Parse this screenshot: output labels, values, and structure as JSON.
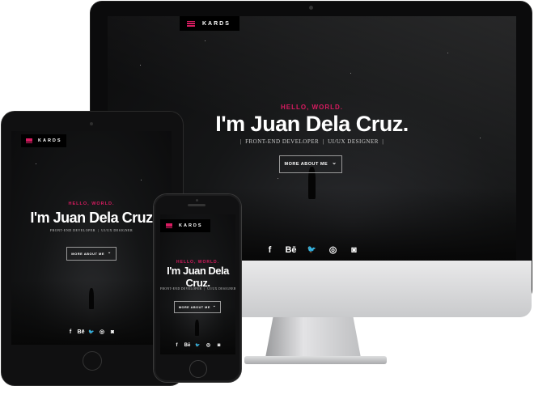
{
  "brand": "KARDS",
  "hero": {
    "greeting": "HELLO, WORLD.",
    "name": "I'm Juan Dela Cruz.",
    "name_tablet": "I'm Juan Dela Cruz",
    "name_phone_line1": "I'm Juan Dela",
    "name_phone_line2": "Cruz.",
    "role_1": "FRONT-END DEVELOPER",
    "role_2": "UI/UX DESIGNER",
    "separator": "|",
    "button": "MORE ABOUT ME",
    "button_chevron": "⌄"
  },
  "social": [
    {
      "icon": "facebook-icon",
      "glyph": "f"
    },
    {
      "icon": "behance-icon",
      "glyph": "Bē"
    },
    {
      "icon": "twitter-icon",
      "glyph": "🐦"
    },
    {
      "icon": "dribbble-icon",
      "glyph": "◎"
    },
    {
      "icon": "instagram-icon",
      "glyph": "◙"
    }
  ],
  "colors": {
    "accent": "#d81b60",
    "screen_bg": "#141516",
    "text": "#ffffff"
  }
}
